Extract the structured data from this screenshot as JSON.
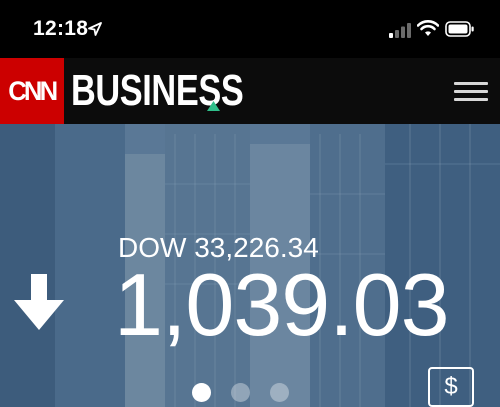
{
  "status_bar": {
    "time": "12:18",
    "icons": [
      "location-icon",
      "signal-icon",
      "wifi-icon",
      "battery-icon"
    ]
  },
  "header": {
    "logo_text": "CNN",
    "title": "BUSINESS",
    "brand_color": "#cc0000",
    "accent_color": "#2fbf8a",
    "menu_icon": "hamburger-menu-icon"
  },
  "market": {
    "index_label": "DOW 33,226.34",
    "change": "1,039.03",
    "direction_icon": "down-arrow-icon"
  },
  "carousel": {
    "pages": 3,
    "active_index": 0
  },
  "currency_button_label": "$"
}
